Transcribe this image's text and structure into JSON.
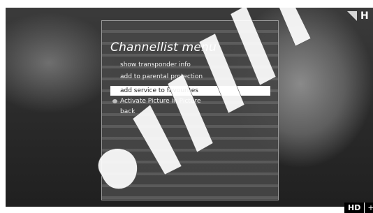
{
  "menu": {
    "title": "Channellist menu",
    "items": [
      {
        "label": "show transponder info"
      },
      {
        "label": "add to parental protection"
      },
      {
        "label": "add service to favourites"
      },
      {
        "label": "Activate Picture in Picture"
      },
      {
        "label": "back"
      }
    ],
    "selected_index": 2
  },
  "badges": {
    "hd": "HD",
    "plus": "+",
    "logo_letter": "H"
  }
}
